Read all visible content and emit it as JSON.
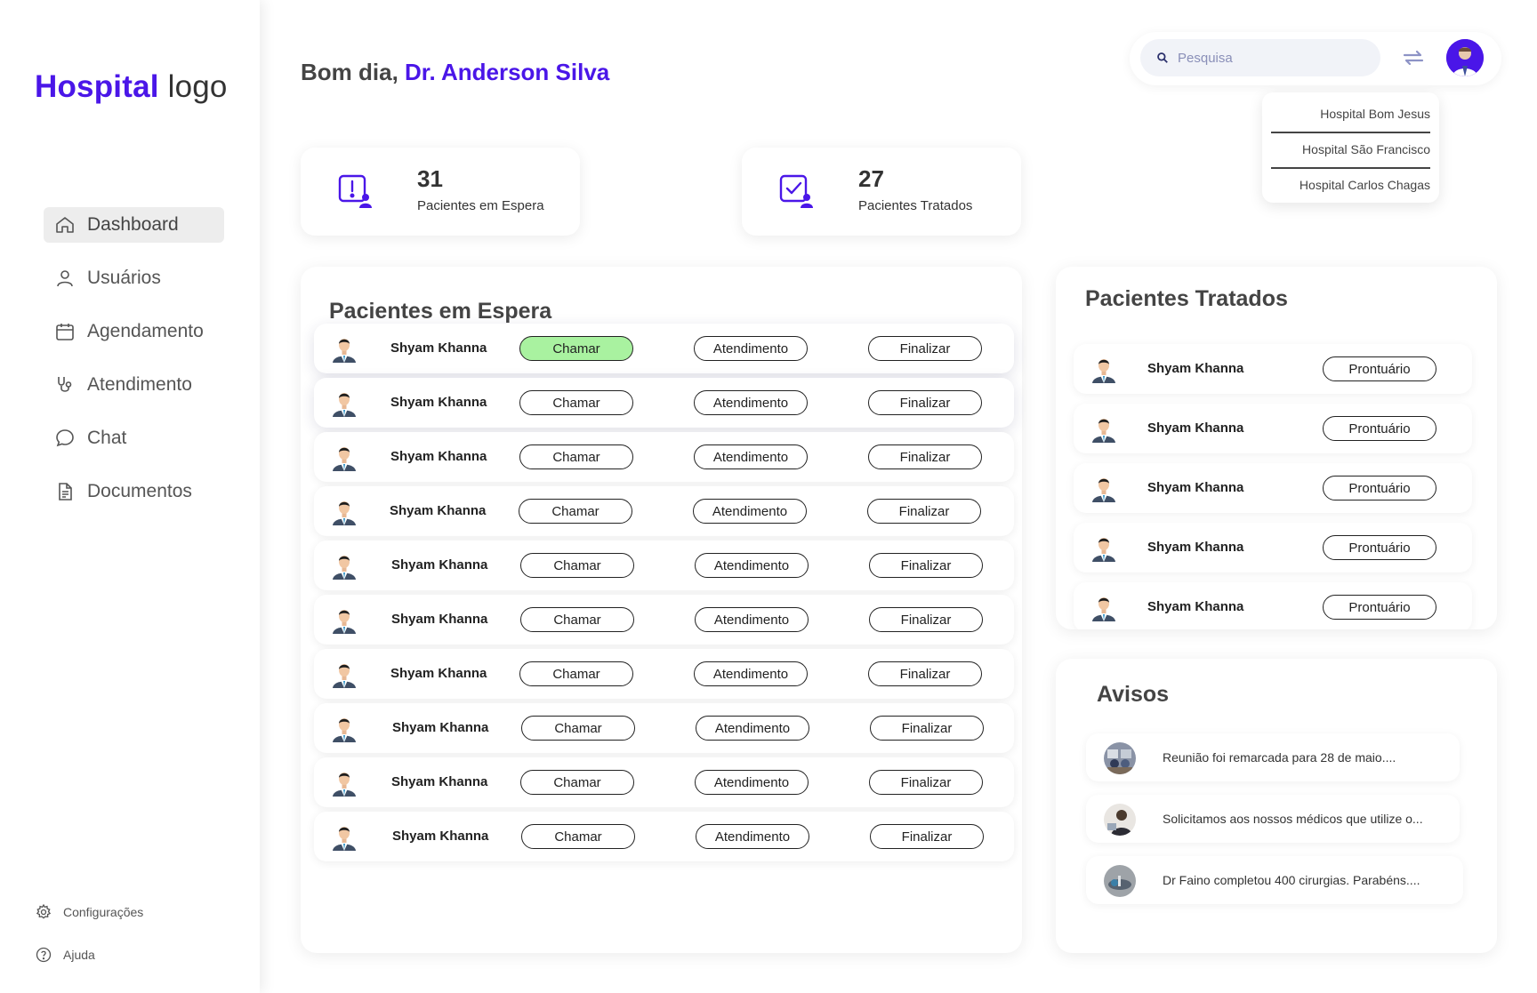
{
  "logo": {
    "brand": "Hospital",
    "suffix": "logo"
  },
  "nav": {
    "items": [
      {
        "label": "Dashboard",
        "icon": "home-icon"
      },
      {
        "label": "Usuários",
        "icon": "user-icon"
      },
      {
        "label": "Agendamento",
        "icon": "calendar-icon"
      },
      {
        "label": "Atendimento",
        "icon": "stethoscope-icon"
      },
      {
        "label": "Chat",
        "icon": "chat-icon"
      },
      {
        "label": "Documentos",
        "icon": "document-icon"
      }
    ],
    "bottom": [
      {
        "label": "Configurações",
        "icon": "gear-icon"
      },
      {
        "label": "Ajuda",
        "icon": "help-icon"
      }
    ]
  },
  "header": {
    "greeting": "Bom dia,",
    "doctor": "Dr. Anderson Silva",
    "search_placeholder": "Pesquisa"
  },
  "hospitals": [
    "Hospital Bom Jesus",
    "Hospital São Francisco",
    "Hospital Carlos Chagas"
  ],
  "stats": {
    "waiting": {
      "value": "31",
      "label": "Pacientes em Espera"
    },
    "treated": {
      "value": "27",
      "label": "Pacientes Tratados"
    }
  },
  "waiting_panel": {
    "title": "Pacientes em Espera",
    "buttons": {
      "call": "Chamar",
      "attend": "Atendimento",
      "finish": "Finalizar"
    },
    "patients": [
      {
        "name": "Shyam Khanna",
        "called": true
      },
      {
        "name": "Shyam Khanna",
        "called": false
      },
      {
        "name": "Shyam Khanna",
        "called": false
      },
      {
        "name": "Shyam Khanna",
        "called": false
      },
      {
        "name": "Shyam Khanna",
        "called": false
      },
      {
        "name": "Shyam Khanna",
        "called": false
      },
      {
        "name": "Shyam Khanna",
        "called": false
      },
      {
        "name": "Shyam Khanna",
        "called": false
      },
      {
        "name": "Shyam Khanna",
        "called": false
      },
      {
        "name": "Shyam Khanna",
        "called": false
      }
    ]
  },
  "treated_panel": {
    "title": "Pacientes Tratados",
    "button": "Prontuário",
    "patients": [
      "Shyam Khanna",
      "Shyam Khanna",
      "Shyam Khanna",
      "Shyam Khanna",
      "Shyam Khanna"
    ]
  },
  "notices_panel": {
    "title": "Avisos",
    "items": [
      "Reunião foi remarcada para 28 de maio....",
      "Solicitamos aos nossos médicos que utilize o...",
      "Dr Faino completou 400 cirurgias. Parabéns...."
    ]
  },
  "colors": {
    "accent": "#4a16e8",
    "called": "#a9f2a0",
    "text": "#222222"
  }
}
